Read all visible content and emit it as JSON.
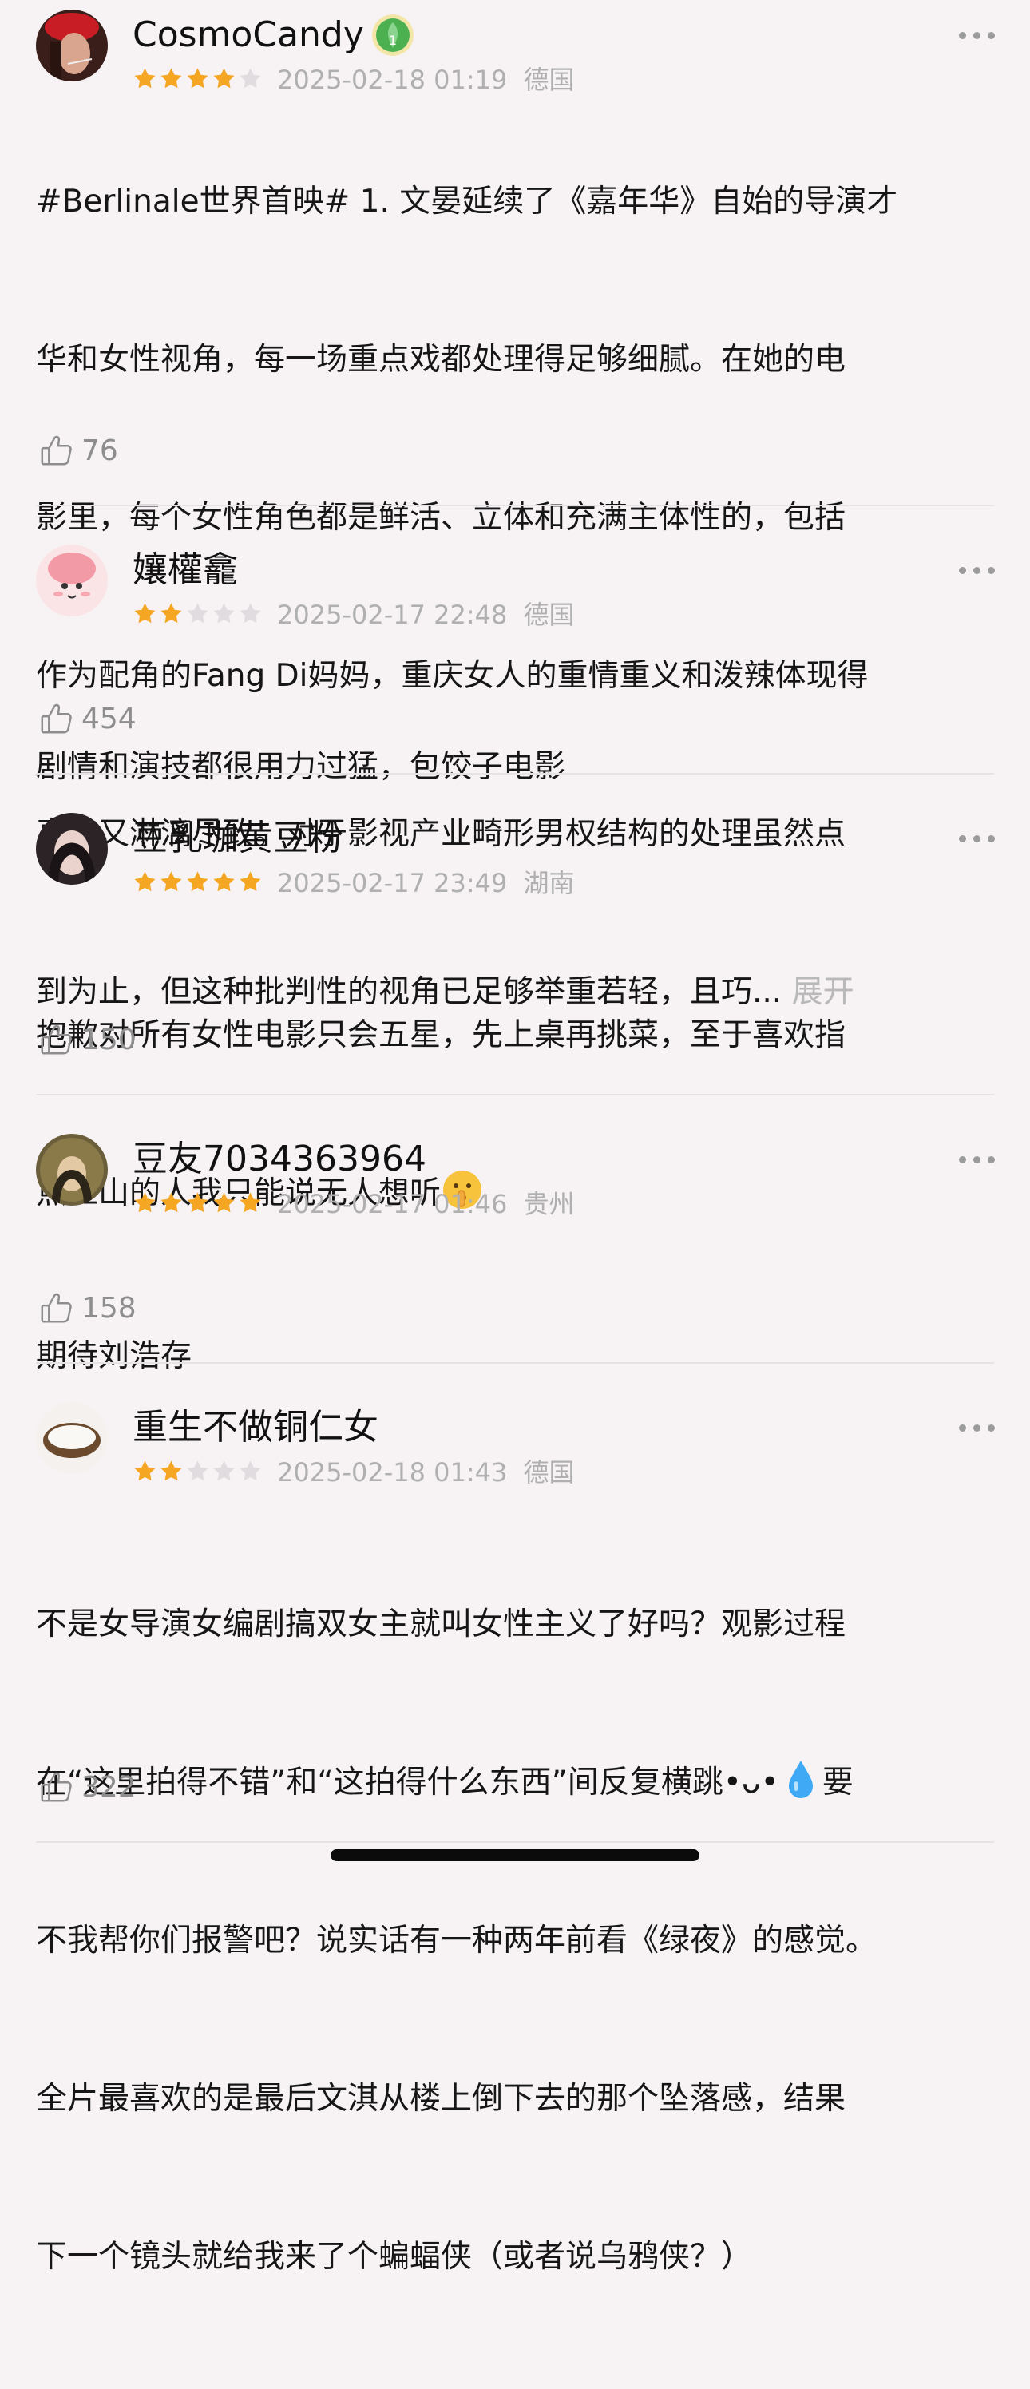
{
  "reviews": [
    {
      "username": "CosmoCandy",
      "rating": 4,
      "date": "2025-02-18 01:19",
      "location": "德国",
      "text_lines": [
        "#Berlinale世界首映# 1. 文晏延续了《嘉年华》自始的导演才",
        "华和女性视角，每一场重点戏都处理得足够细腻。在她的电",
        "影里，每个女性角色都是鲜活、立体和充满主体性的，包括",
        "作为配角的Fang Di妈妈，重庆女人的重情重义和泼辣体现得",
        "真实又淋漓尽致。对于影视产业畸形男权结构的处理虽然点",
        "到为止，但这种批判性的视角已足够举重若轻，且巧..."
      ],
      "expand_label": "展开",
      "likes": "76"
    },
    {
      "username": "孃權龕",
      "rating": 2,
      "date": "2025-02-17 22:48",
      "location": "德国",
      "text_lines": [
        "剧情和演技都很用力过猛，包饺子电影"
      ],
      "likes": "454"
    },
    {
      "username": "豆乳珈黄豆粉",
      "rating": 5,
      "date": "2025-02-17 23:49",
      "location": "湖南",
      "text_lines": [
        "抱歉对所有女性电影只会五星，先上桌再挑菜，至于喜欢指",
        "点江山的人我只能说无人想听"
      ],
      "likes": "150"
    },
    {
      "username": "豆友7034363964",
      "rating": 5,
      "date": "2025-02-17 01:46",
      "location": "贵州",
      "text_lines": [
        "期待刘浩存"
      ],
      "likes": "158"
    },
    {
      "username": "重生不做铜仁女",
      "rating": 2,
      "date": "2025-02-18 01:43",
      "location": "德国",
      "text_lines": [
        "不是女导演女编剧搞双女主就叫女性主义了好吗？观影过程",
        "在“这里拍得不错”和“这拍得什么东西”间反复横跳•ᴗ•",
        "不我帮你们报警吧？说实话有一种两年前看《绿夜》的感觉。",
        "全片最喜欢的是最后文淇从楼上倒下去的那个坠落感，结果",
        "下一个镜头就给我来了个蝙蝠侠（或者说乌鸦侠？）"
      ],
      "line2_suffix": "要",
      "likes": "322"
    }
  ],
  "colors": {
    "star_on": "#f5a623",
    "star_off": "#e0dcdf",
    "meta": "#b0b0b0",
    "badge": "#4caf50"
  }
}
